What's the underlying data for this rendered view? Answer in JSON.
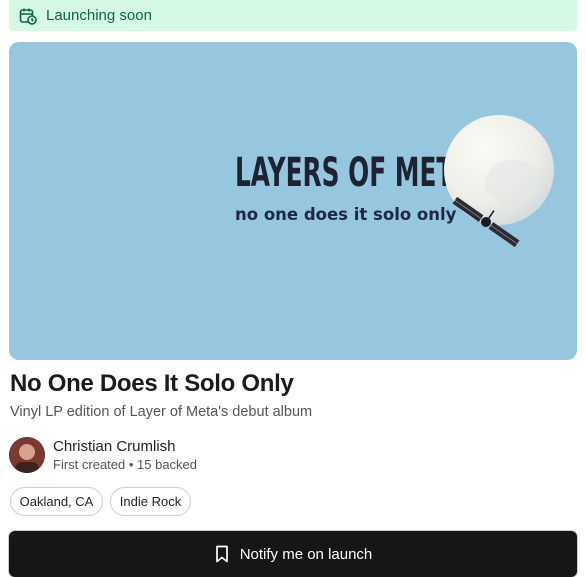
{
  "banner": {
    "text": "Launching soon",
    "icon": "calendar-clock-icon"
  },
  "hero": {
    "title": "LAYERS OF META",
    "subtitle": "no one does it solo only"
  },
  "project": {
    "title": "No One Does It Solo Only",
    "description": "Vinyl LP edition of Layer of Meta's debut album"
  },
  "creator": {
    "name": "Christian Crumlish",
    "meta": "First created • 15 backed"
  },
  "tags": [
    "Oakland, CA",
    "Indie Rock"
  ],
  "cta": {
    "label": "Notify me on launch",
    "icon": "bookmark-icon"
  },
  "colors": {
    "banner_bg": "#d5f9e4",
    "banner_text": "#0a6b3b",
    "hero_bg": "#97c6df",
    "cta_bg": "#161616"
  }
}
